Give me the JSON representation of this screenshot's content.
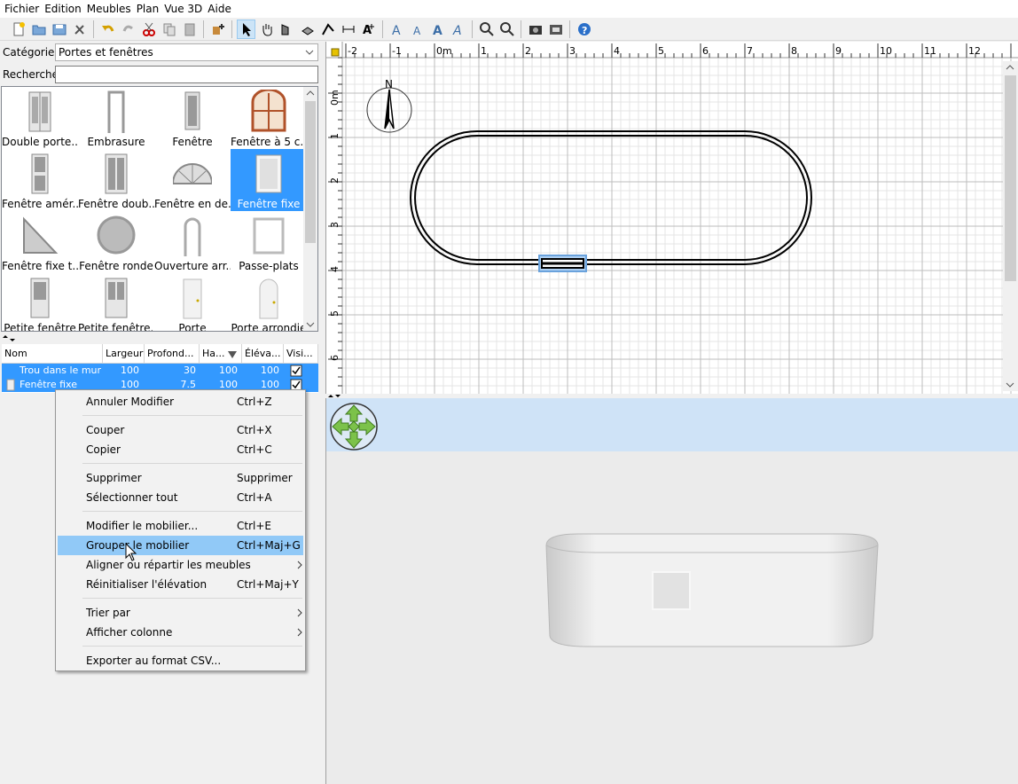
{
  "menubar": {
    "items": [
      "Fichier",
      "Edition",
      "Meubles",
      "Plan",
      "Vue 3D",
      "Aide"
    ]
  },
  "toolbar": {
    "icons": [
      "new-home",
      "open",
      "save",
      "preferences",
      "undo",
      "redo",
      "cut",
      "copy",
      "paste",
      "add-furniture",
      "select-mode",
      "pan-mode",
      "create-walls",
      "create-rooms",
      "create-dimensions",
      "create-labels",
      "add-text",
      "increase-text",
      "decrease-text",
      "bold-text",
      "italic-text",
      "zoom-in",
      "zoom-out",
      "photo",
      "video",
      "help"
    ]
  },
  "catalog": {
    "category_label": "Catégorie:",
    "category_value": "Portes et fenêtres",
    "search_label": "Recherche:",
    "search_value": "",
    "items": [
      {
        "label": "Double porte..."
      },
      {
        "label": "Embrasure"
      },
      {
        "label": "Fenêtre"
      },
      {
        "label": "Fenêtre à 5 c..."
      },
      {
        "label": "Fenêtre amér..."
      },
      {
        "label": "Fenêtre doub..."
      },
      {
        "label": "Fenêtre en de..."
      },
      {
        "label": "Fenêtre fixe",
        "selected": true
      },
      {
        "label": "Fenêtre fixe t..."
      },
      {
        "label": "Fenêtre ronde"
      },
      {
        "label": "Ouverture arr..."
      },
      {
        "label": "Passe-plats"
      },
      {
        "label": "Petite fenêtre"
      },
      {
        "label": "Petite fenêtre..."
      },
      {
        "label": "Porte"
      },
      {
        "label": "Porte arrondie"
      }
    ]
  },
  "furniture_table": {
    "columns": [
      "Nom",
      "Largeur",
      "Profond...",
      "Ha...",
      "Éléva...",
      "Visi..."
    ],
    "sorted_column_icon": "sort-desc-icon",
    "rows": [
      {
        "name": "Trou dans le mur",
        "width": "100",
        "depth": "30",
        "height": "100",
        "elevation": "100",
        "visible": true
      },
      {
        "name": "Fenêtre fixe",
        "width": "100",
        "depth": "7.5",
        "height": "100",
        "elevation": "100",
        "visible": true
      }
    ]
  },
  "context_menu": {
    "items": [
      {
        "label": "Annuler Modifier",
        "shortcut": "Ctrl+Z"
      },
      {
        "label": "Couper",
        "shortcut": "Ctrl+X"
      },
      {
        "label": "Copier",
        "shortcut": "Ctrl+C"
      },
      {
        "label": "Supprimer",
        "shortcut": "Supprimer"
      },
      {
        "label": "Sélectionner tout",
        "shortcut": "Ctrl+A"
      },
      {
        "label": "Modifier le mobilier...",
        "shortcut": "Ctrl+E"
      },
      {
        "label": "Grouper le mobilier",
        "shortcut": "Ctrl+Maj+G",
        "highlighted": true
      },
      {
        "label": "Aligner ou répartir les meubles",
        "shortcut": "",
        "submenu": true
      },
      {
        "label": "Réinitialiser l'élévation",
        "shortcut": "Ctrl+Maj+Y"
      },
      {
        "label": "Trier par",
        "shortcut": "",
        "submenu": true
      },
      {
        "label": "Afficher colonne",
        "shortcut": "",
        "submenu": true
      },
      {
        "label": "Exporter au format CSV...",
        "shortcut": ""
      }
    ]
  },
  "plan": {
    "ruler_x": [
      "-2",
      "-1",
      "0m",
      "1",
      "2",
      "3",
      "4",
      "5",
      "6",
      "7",
      "8",
      "9",
      "10",
      "11",
      "12"
    ],
    "ruler_y": [
      "0m",
      "1",
      "2",
      "3",
      "4",
      "5",
      "6"
    ],
    "compass_label": "N"
  },
  "colors": {
    "selection": "#3399ff",
    "menu_highlight": "#91c9f7",
    "view3d_band": "#cfe3f7"
  }
}
